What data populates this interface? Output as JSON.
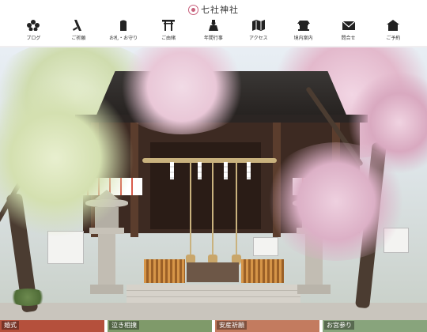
{
  "site": {
    "logo_text": "七社神社"
  },
  "nav": {
    "items": [
      {
        "label": "ブログ",
        "icon": "flower-icon"
      },
      {
        "label": "ご祈願",
        "icon": "brush-icon"
      },
      {
        "label": "お札・お守り",
        "icon": "amulet-icon"
      },
      {
        "label": "ご由緒",
        "icon": "torii-icon"
      },
      {
        "label": "年間行事",
        "icon": "priest-icon"
      },
      {
        "label": "アクセス",
        "icon": "map-icon"
      },
      {
        "label": "境内案内",
        "icon": "shrine-icon"
      },
      {
        "label": "問合せ",
        "icon": "mail-icon"
      },
      {
        "label": "ご予約",
        "icon": "house-icon"
      }
    ]
  },
  "features": [
    {
      "label": "婚式",
      "color": "#b5503c"
    },
    {
      "label": "泣き相撲",
      "color": "#7f9a6a"
    },
    {
      "label": "安産祈願",
      "color": "#c37b5f"
    },
    {
      "label": "お宮参り",
      "color": "#88a47c"
    }
  ],
  "colors": {
    "accent": "#c8617d",
    "nav_icon": "#222222"
  }
}
